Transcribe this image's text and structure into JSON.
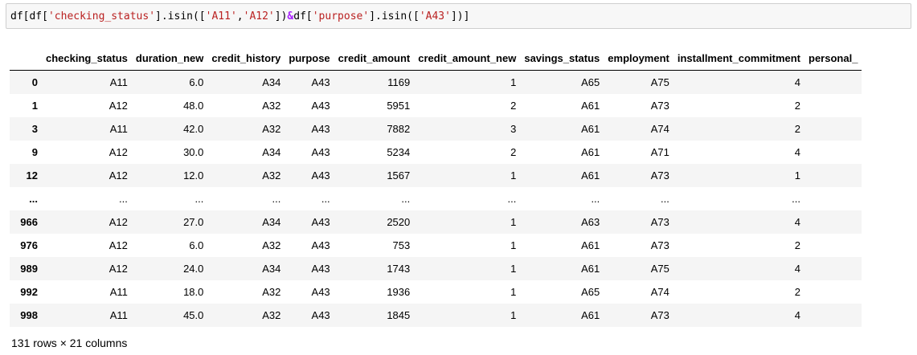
{
  "code_cell": {
    "tokens": [
      {
        "t": "df[df[",
        "c": ""
      },
      {
        "t": "'checking_status'",
        "c": "str"
      },
      {
        "t": "].isin([",
        "c": ""
      },
      {
        "t": "'A11'",
        "c": "str"
      },
      {
        "t": ",",
        "c": ""
      },
      {
        "t": "'A12'",
        "c": "str"
      },
      {
        "t": "])",
        "c": ""
      },
      {
        "t": "&",
        "c": "op"
      },
      {
        "t": "df[",
        "c": ""
      },
      {
        "t": "'purpose'",
        "c": "str"
      },
      {
        "t": "].isin([",
        "c": ""
      },
      {
        "t": "'A43'",
        "c": "str"
      },
      {
        "t": "])]",
        "c": ""
      }
    ]
  },
  "table": {
    "columns": [
      "checking_status",
      "duration_new",
      "credit_history",
      "purpose",
      "credit_amount",
      "credit_amount_new",
      "savings_status",
      "employment",
      "installment_commitment",
      "personal_"
    ],
    "rows": [
      {
        "index": "0",
        "cells": [
          "A11",
          "6.0",
          "A34",
          "A43",
          "1169",
          "1",
          "A65",
          "A75",
          "4",
          ""
        ]
      },
      {
        "index": "1",
        "cells": [
          "A12",
          "48.0",
          "A32",
          "A43",
          "5951",
          "2",
          "A61",
          "A73",
          "2",
          ""
        ]
      },
      {
        "index": "3",
        "cells": [
          "A11",
          "42.0",
          "A32",
          "A43",
          "7882",
          "3",
          "A61",
          "A74",
          "2",
          ""
        ]
      },
      {
        "index": "9",
        "cells": [
          "A12",
          "30.0",
          "A34",
          "A43",
          "5234",
          "2",
          "A61",
          "A71",
          "4",
          ""
        ]
      },
      {
        "index": "12",
        "cells": [
          "A12",
          "12.0",
          "A32",
          "A43",
          "1567",
          "1",
          "A61",
          "A73",
          "1",
          ""
        ]
      },
      {
        "index": "...",
        "cells": [
          "...",
          "...",
          "...",
          "...",
          "...",
          "...",
          "...",
          "...",
          "...",
          ""
        ]
      },
      {
        "index": "966",
        "cells": [
          "A12",
          "27.0",
          "A34",
          "A43",
          "2520",
          "1",
          "A63",
          "A73",
          "4",
          ""
        ]
      },
      {
        "index": "976",
        "cells": [
          "A12",
          "6.0",
          "A32",
          "A43",
          "753",
          "1",
          "A61",
          "A73",
          "2",
          ""
        ]
      },
      {
        "index": "989",
        "cells": [
          "A12",
          "24.0",
          "A34",
          "A43",
          "1743",
          "1",
          "A61",
          "A75",
          "4",
          ""
        ]
      },
      {
        "index": "992",
        "cells": [
          "A11",
          "18.0",
          "A32",
          "A43",
          "1936",
          "1",
          "A65",
          "A74",
          "2",
          ""
        ]
      },
      {
        "index": "998",
        "cells": [
          "A11",
          "45.0",
          "A32",
          "A43",
          "1845",
          "1",
          "A61",
          "A73",
          "4",
          ""
        ]
      }
    ]
  },
  "shape_text": "131 rows × 21 columns"
}
